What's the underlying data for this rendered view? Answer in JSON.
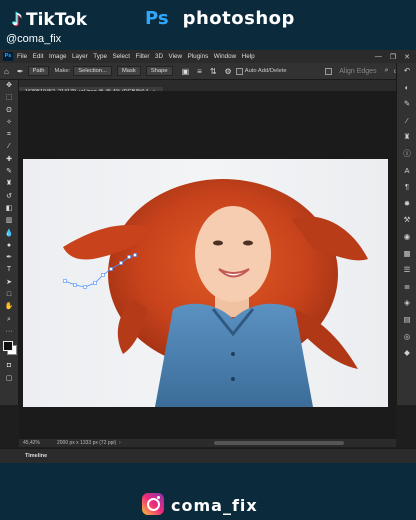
{
  "banner": {
    "tiktok_label": "TikTok",
    "handle": "@coma_fix",
    "ps_badge": "Ps",
    "ps_word": "photoshop"
  },
  "menubar": {
    "app_icon": "Ps",
    "items": [
      "File",
      "Edit",
      "Image",
      "Layer",
      "Type",
      "Select",
      "Filter",
      "3D",
      "View",
      "Plugins",
      "Window",
      "Help"
    ],
    "window_buttons": [
      "—",
      "❐",
      "✕"
    ]
  },
  "options_bar": {
    "home_icon": "home-icon",
    "tool_icon": "pen-tool-icon",
    "mode_value": "Path",
    "make_label": "Make:",
    "selection_btn": "Selection...",
    "mask_btn": "Mask",
    "shape_btn": "Shape",
    "auto_add_delete": "Auto Add/Delete",
    "align_edges": "Align Edges"
  },
  "document": {
    "tab_title": "1639519452_214179_url.jpeg @ 45,4% (RGB/8#) *",
    "close_glyph": "×"
  },
  "status": {
    "zoom": "45,42%",
    "dimensions": "2000 px x 1333 px (72 ppi)",
    "arrow": "›"
  },
  "timeline": {
    "label": "Timeline"
  },
  "footer": {
    "insta_handle": "coma_fix"
  },
  "colors": {
    "ps_blue": "#31a8ff",
    "app_background": "#1e1e1e",
    "panel": "#323232",
    "banner_background": "#0b2a3c",
    "hair": "#c8431c",
    "shirt": "#4a7fae",
    "path": "#4a90ff"
  }
}
